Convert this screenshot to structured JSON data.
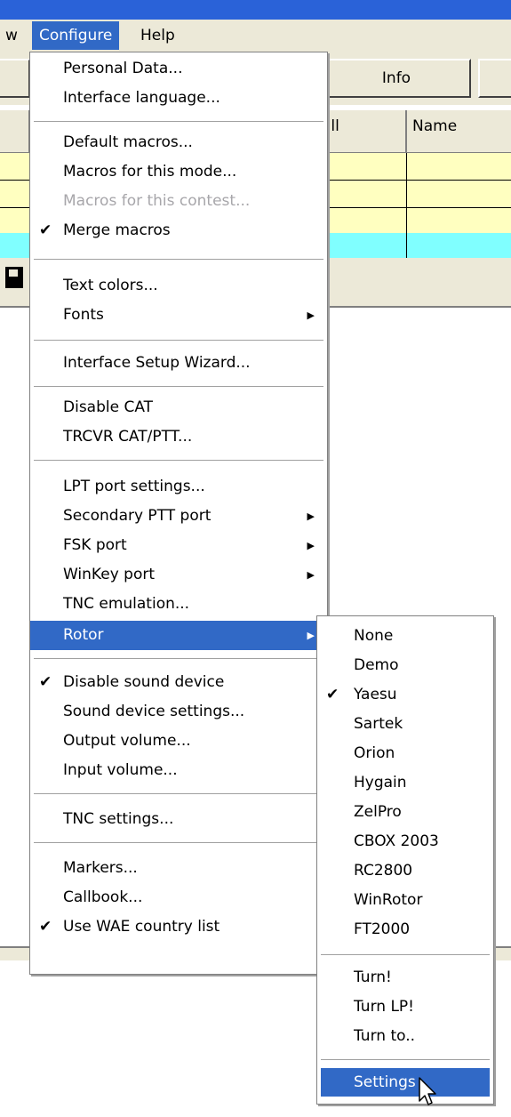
{
  "menubar": {
    "partial_left": "w",
    "configure": "Configure",
    "help": "Help"
  },
  "toolbar": {
    "info_button": "Info"
  },
  "grid": {
    "col_call_partial": "all",
    "col_name": "Name"
  },
  "row_colors": [
    "#ffffc0",
    "#ffffc0",
    "#ffffc0",
    "#80ffff"
  ],
  "configure_menu": {
    "personal_data": "Personal Data...",
    "interface_language": "Interface language...",
    "default_macros": "Default macros...",
    "macros_mode": "Macros for this mode...",
    "macros_contest": "Macros for this contest...",
    "merge_macros": "Merge macros",
    "text_colors": "Text colors...",
    "fonts": "Fonts",
    "setup_wizard": "Interface Setup Wizard...",
    "disable_cat": "Disable CAT",
    "trcvr_cat": "TRCVR CAT/PTT...",
    "lpt_settings": "LPT port settings...",
    "secondary_ptt": "Secondary PTT port",
    "fsk_port": "FSK port",
    "winkey_port": "WinKey port",
    "tnc_emulation": "TNC emulation...",
    "rotor": "Rotor",
    "disable_sound": "Disable sound device",
    "sound_settings": "Sound device settings...",
    "output_volume": "Output volume...",
    "input_volume": "Input volume...",
    "tnc_settings": "TNC settings...",
    "markers": "Markers...",
    "callbook": "Callbook...",
    "wae_list": "Use WAE country list",
    "check_glyph": "✔",
    "arrow_glyph": "▶"
  },
  "rotor_menu": {
    "none": "None",
    "demo": "Demo",
    "yaesu": "Yaesu",
    "sartek": "Sartek",
    "orion": "Orion",
    "hygain": "Hygain",
    "zelpro": "ZelPro",
    "cbox": "CBOX 2003",
    "rc2800": "RC2800",
    "winrotor": "WinRotor",
    "ft2000": "FT2000",
    "turn": "Turn!",
    "turn_lp": "Turn LP!",
    "turn_to": "Turn to..",
    "settings": "Settings"
  },
  "colors": {
    "highlight": "#3169c6",
    "face": "#ece9d8",
    "disabled": "#a7a6aa"
  }
}
